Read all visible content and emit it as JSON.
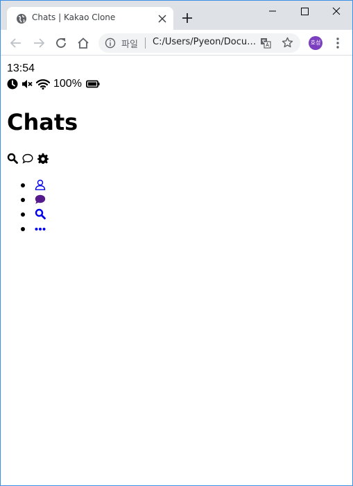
{
  "browser": {
    "tab_title": "Chats | Kakao Clone",
    "omnibox_label": "파일",
    "url": "C:/Users/Pyeon/Documents/kakao-clone/chats.html",
    "avatar_text": "호성",
    "accent_color": "#7b3fbf"
  },
  "status_bar": {
    "time": "13:54",
    "battery_text": "100%",
    "icons": [
      "clock-icon",
      "volume-mute-icon",
      "wifi-icon",
      "battery-icon"
    ]
  },
  "header": {
    "title": "Chats",
    "actions": [
      "search-icon",
      "chat-bubble-icon",
      "gear-icon"
    ]
  },
  "tab_bar": {
    "items": [
      {
        "icon": "user-icon",
        "color": "#0000ee"
      },
      {
        "icon": "comment-icon",
        "color": "#551a8b"
      },
      {
        "icon": "search-icon",
        "color": "#0000ee"
      },
      {
        "icon": "ellipsis-icon",
        "color": "#0000ee"
      }
    ]
  }
}
